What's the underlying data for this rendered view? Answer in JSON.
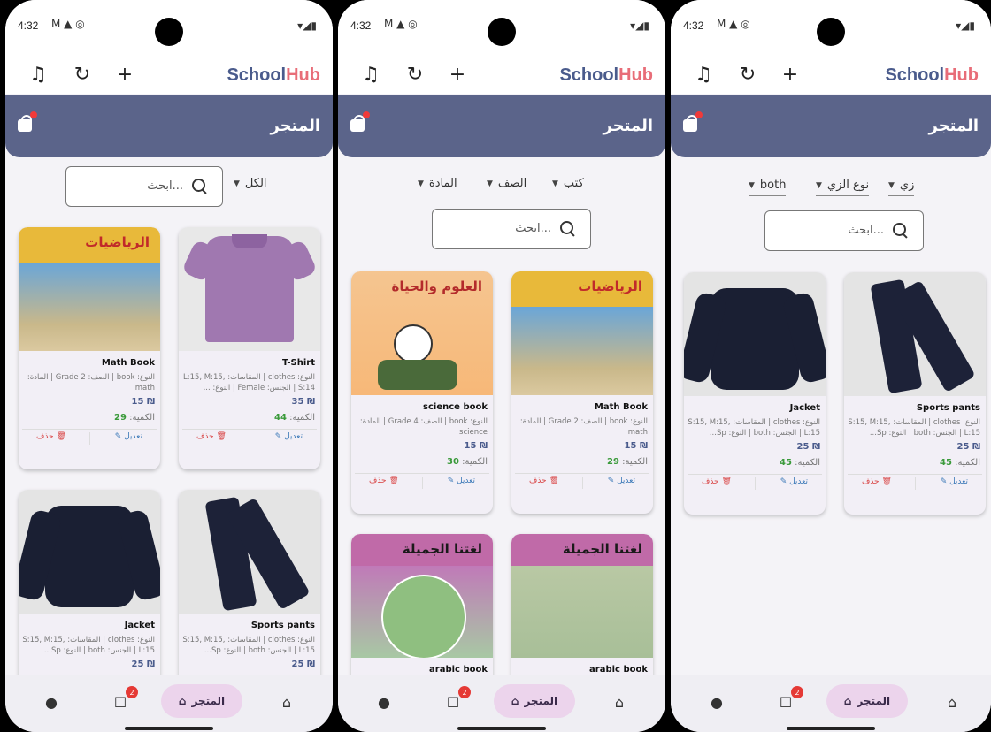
{
  "status": {
    "time": "4:32",
    "icons": "M ▲ ◎",
    "right": "▾◢▮"
  },
  "app": {
    "brand_a": "School",
    "brand_b": "Hub",
    "header_title": "المتجر"
  },
  "search": {
    "placeholder": "ابحث..."
  },
  "screens": [
    {
      "filters": [
        {
          "label": "الكل"
        }
      ],
      "cards": [
        {
          "name": "T-Shirt",
          "meta": "النوع: clothes | المقاسات: L:15, M:15, S:14 | الجنس: Female | النوع: ...",
          "price": "35 ₪",
          "qty_label": "الكمية:",
          "qty": "44",
          "edit": "تعديل",
          "del": "حذف"
        },
        {
          "name": "Math Book",
          "meta": "النوع: book | الصف: Grade 2 | المادة: math",
          "price": "15 ₪",
          "qty_label": "الكمية:",
          "qty": "29",
          "edit": "تعديل",
          "del": "حذف",
          "book_title": "الرياضيات"
        },
        {
          "name": "Sports pants",
          "meta": "النوع: clothes | المقاسات: S:15, M:15, L:15 | الجنس: both | النوع: Sp...",
          "price": "25 ₪"
        },
        {
          "name": "Jacket",
          "meta": "النوع: clothes | المقاسات: S:15, M:15, L:15 | الجنس: both | النوع: Sp...",
          "price": "25 ₪"
        }
      ]
    },
    {
      "filters": [
        {
          "label": "كتب"
        },
        {
          "label": "الصف"
        },
        {
          "label": "المادة"
        }
      ],
      "cards": [
        {
          "name": "Math Book",
          "meta": "النوع: book | الصف: Grade 2 | المادة: math",
          "price": "15 ₪",
          "qty_label": "الكمية:",
          "qty": "29",
          "edit": "تعديل",
          "del": "حذف",
          "book_title": "الرياضيات"
        },
        {
          "name": "science book",
          "meta": "النوع: book | الصف: Grade 4 | المادة: science",
          "price": "15 ₪",
          "qty_label": "الكمية:",
          "qty": "30",
          "edit": "تعديل",
          "del": "حذف",
          "book_title": "العلوم والحياة"
        },
        {
          "name": "arabic book",
          "book_title": "لغتنا الجميلة"
        },
        {
          "name": "arabic book",
          "book_title": "لغتنا الجميلة"
        }
      ]
    },
    {
      "filters": [
        {
          "label": "زي"
        },
        {
          "label": "نوع الزي"
        },
        {
          "label": "both"
        }
      ],
      "cards": [
        {
          "name": "Sports pants",
          "meta": "النوع: clothes | المقاسات: S:15, M:15, L:15 | الجنس: both | النوع: Sp...",
          "price": "25 ₪",
          "qty_label": "الكمية:",
          "qty": "45",
          "edit": "تعديل",
          "del": "حذف"
        },
        {
          "name": "Jacket",
          "meta": "النوع: clothes | المقاسات: S:15, M:15, L:15 | الجنس: both | النوع: Sp...",
          "price": "25 ₪",
          "qty_label": "الكمية:",
          "qty": "45",
          "edit": "تعديل",
          "del": "حذف"
        }
      ]
    }
  ],
  "nav": {
    "store_label": "المتجر",
    "chat_badge": "2"
  },
  "colors": {
    "header": "#5b648a",
    "brand_school": "#4a5b8c",
    "brand_hub": "#e86d78",
    "pill": "#ecd4ec",
    "badge": "#e53935"
  }
}
